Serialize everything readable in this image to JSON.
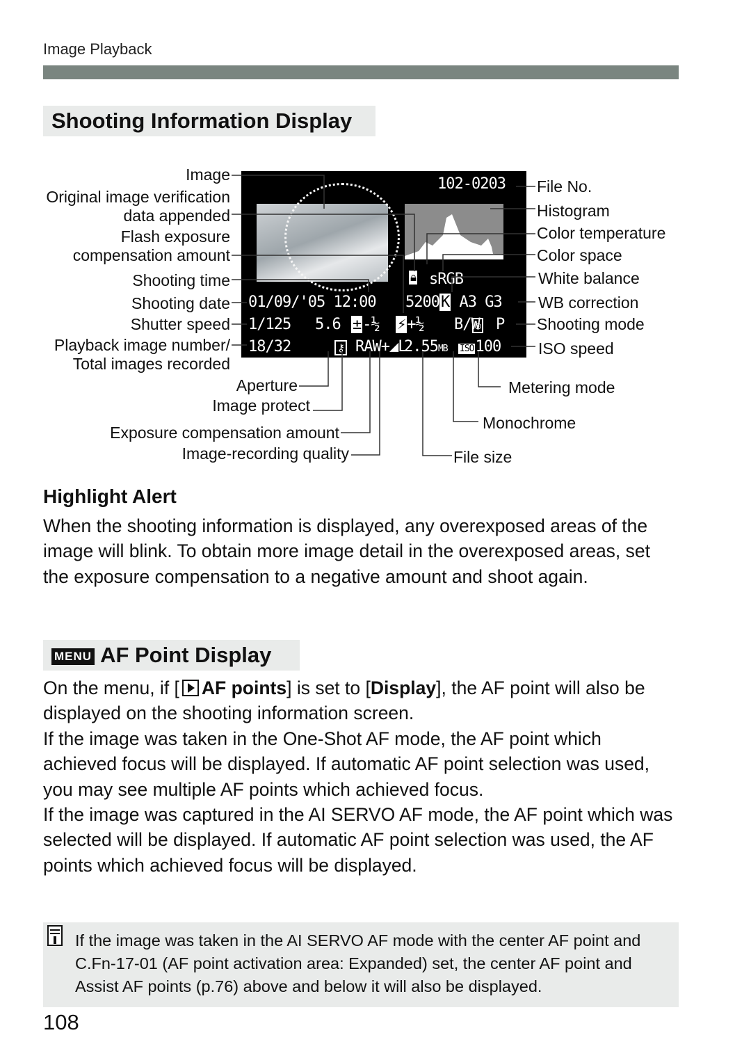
{
  "header": {
    "section": "Image Playback"
  },
  "shooting_info": {
    "title": "Shooting Information Display",
    "screen": {
      "file_no": "102-0203",
      "color_space": "sRGB",
      "date_time": "01/09/'05 12:00",
      "color_temp": "5200",
      "wb_icon": "K",
      "wb_correction": "A3 G3",
      "shutter": "1/125",
      "aperture": "5.6",
      "exp_comp": "-½",
      "flash_comp": "+½",
      "monochrome": "B/W",
      "shooting_mode": "P",
      "playback_number": "18/32",
      "quality": "RAW+◢L",
      "file_size": "2.55",
      "file_size_unit": "MB",
      "iso_icon": "ISO",
      "iso": "100"
    },
    "left_labels": [
      "Image",
      "Original image verification data appended",
      "Flash exposure compensation amount",
      "Shooting time",
      "Shooting date",
      "Shutter speed",
      "Playback image number/ Total images recorded"
    ],
    "bottom_left_labels": [
      "Aperture",
      "Image protect",
      "Exposure compensation amount",
      "Image-recording quality"
    ],
    "right_labels": [
      "File No.",
      "Histogram",
      "Color temperature",
      "Color space",
      "White balance",
      "WB correction",
      "Shooting mode",
      "ISO speed"
    ],
    "bottom_right_labels": [
      "Metering mode",
      "Monochrome",
      "File size"
    ]
  },
  "highlight": {
    "title": "Highlight Alert",
    "text": "When the shooting information is displayed, any overexposed areas of the image will blink. To obtain more image detail in the overexposed areas, set the exposure compensation to a negative amount and shoot again."
  },
  "af": {
    "menu_icon": "MENU",
    "title": "AF Point Display",
    "p1_a": "On the menu, if [",
    "p1_bold1": "AF points",
    "p1_b": "] is set to [",
    "p1_bold2": "Display",
    "p1_c": "], the AF point will also be displayed on the shooting information screen.",
    "p2": "If the image was taken in the One-Shot AF mode, the AF point which achieved focus will be displayed. If automatic AF point selection was used, you may see multiple AF points which achieved focus.",
    "p3": "If the image was captured in the AI SERVO AF mode, the AF point which was selected will be displayed. If automatic AF point selection was used, the AF points which achieved focus will be displayed."
  },
  "note": {
    "icon": "note-icon",
    "text": "If the image was taken in the AI SERVO AF mode with the center AF point and C.Fn-17-01 (AF point activation area: Expanded) set, the center AF point and Assist AF points (p.76) above and below it will also be displayed."
  },
  "page_number": "108"
}
